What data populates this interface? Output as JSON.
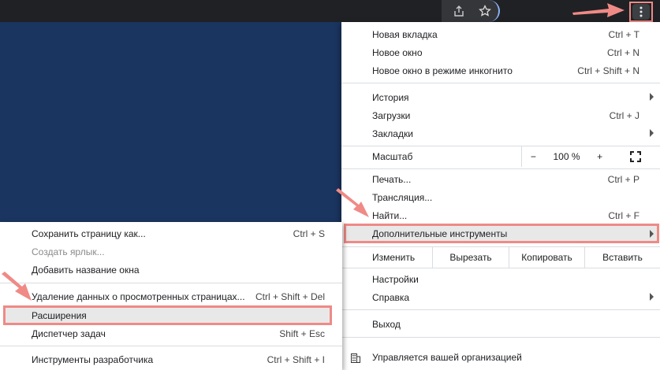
{
  "accent": "#ef8a86",
  "toolbar": {
    "share_icon": "share-icon",
    "star_icon": "star-icon",
    "menu_icon": "kebab-menu-icon"
  },
  "menu": {
    "new_tab": {
      "label": "Новая вкладка",
      "shortcut": "Ctrl + T"
    },
    "new_window": {
      "label": "Новое окно",
      "shortcut": "Ctrl + N"
    },
    "incognito": {
      "label": "Новое окно в режиме инкогнито",
      "shortcut": "Ctrl + Shift + N"
    },
    "history": {
      "label": "История"
    },
    "downloads": {
      "label": "Загрузки",
      "shortcut": "Ctrl + J"
    },
    "bookmarks": {
      "label": "Закладки"
    },
    "zoom": {
      "label": "Масштаб",
      "minus": "−",
      "value": "100 %",
      "plus": "+"
    },
    "print": {
      "label": "Печать...",
      "shortcut": "Ctrl + P"
    },
    "cast": {
      "label": "Трансляция..."
    },
    "find": {
      "label": "Найти...",
      "shortcut": "Ctrl + F"
    },
    "more_tools": {
      "label": "Дополнительные инструменты"
    },
    "edit": {
      "label": "Изменить",
      "cut": "Вырезать",
      "copy": "Копировать",
      "paste": "Вставить"
    },
    "settings": {
      "label": "Настройки"
    },
    "help": {
      "label": "Справка"
    },
    "exit": {
      "label": "Выход"
    },
    "managed": {
      "label": "Управляется вашей организацией"
    }
  },
  "submenu": {
    "save_page": {
      "label": "Сохранить страницу как...",
      "shortcut": "Ctrl + S"
    },
    "create_shortcut": {
      "label": "Создать ярлык..."
    },
    "name_window": {
      "label": "Добавить название окна"
    },
    "clear_data": {
      "label": "Удаление данных о просмотренных страницах...",
      "shortcut": "Ctrl + Shift + Del"
    },
    "extensions": {
      "label": "Расширения"
    },
    "task_manager": {
      "label": "Диспетчер задач",
      "shortcut": "Shift + Esc"
    },
    "dev_tools": {
      "label": "Инструменты разработчика",
      "shortcut": "Ctrl + Shift + I"
    }
  }
}
